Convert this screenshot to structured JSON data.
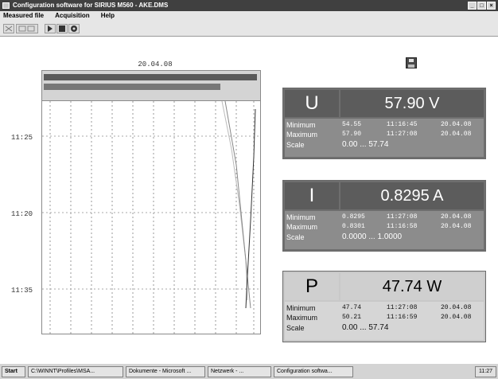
{
  "window": {
    "title": "Configuration software for SIRIUS M560 - AKE.DMS",
    "buttons": [
      "_",
      "□",
      "×"
    ]
  },
  "menu": [
    {
      "label": "Measured file"
    },
    {
      "label": "Acquisition"
    },
    {
      "label": "Help"
    }
  ],
  "toolbar": {
    "icons": [
      "cut-icon",
      "copy-paste-icon",
      "play-icon",
      "stop-icon",
      "settings-icon"
    ]
  },
  "chart": {
    "date": "20.04.08",
    "time_labels": [
      "11:25",
      "11:20",
      "11:35"
    ]
  },
  "panels": [
    {
      "symbol": "U",
      "value": "57.90 V",
      "style": "dark",
      "min": {
        "label": "Minimum",
        "value": "54.55",
        "time": "11:16:45",
        "date": "20.04.08"
      },
      "max": {
        "label": "Maximum",
        "value": "57.90",
        "time": "11:27:08",
        "date": "20.04.08"
      },
      "scale": {
        "label": "Scale",
        "range": "0.00 ... 57.74"
      }
    },
    {
      "symbol": "I",
      "value": "0.8295 A",
      "style": "dark",
      "min": {
        "label": "Minimum",
        "value": "0.8295",
        "time": "11:27:08",
        "date": "20.04.08"
      },
      "max": {
        "label": "Maximum",
        "value": "0.8301",
        "time": "11:16:58",
        "date": "20.04.08"
      },
      "scale": {
        "label": "Scale",
        "range": "0.0000 ... 1.0000"
      }
    },
    {
      "symbol": "P",
      "value": "47.74 W",
      "style": "light",
      "min": {
        "label": "Minimum",
        "value": "47.74",
        "time": "11:27:08",
        "date": "20.04.08"
      },
      "max": {
        "label": "Maximum",
        "value": "50.21",
        "time": "11:16:59",
        "date": "20.04.08"
      },
      "scale": {
        "label": "Scale",
        "range": "0.00 ... 57.74"
      }
    }
  ],
  "taskbar": {
    "start": "Start",
    "tasks": [
      "C:\\WINNT\\Profiles\\MSA...",
      "Dokumente - Microsoft ...",
      "Netzwerk - ...",
      "Configuration softwa..."
    ],
    "tray": "11:27"
  }
}
